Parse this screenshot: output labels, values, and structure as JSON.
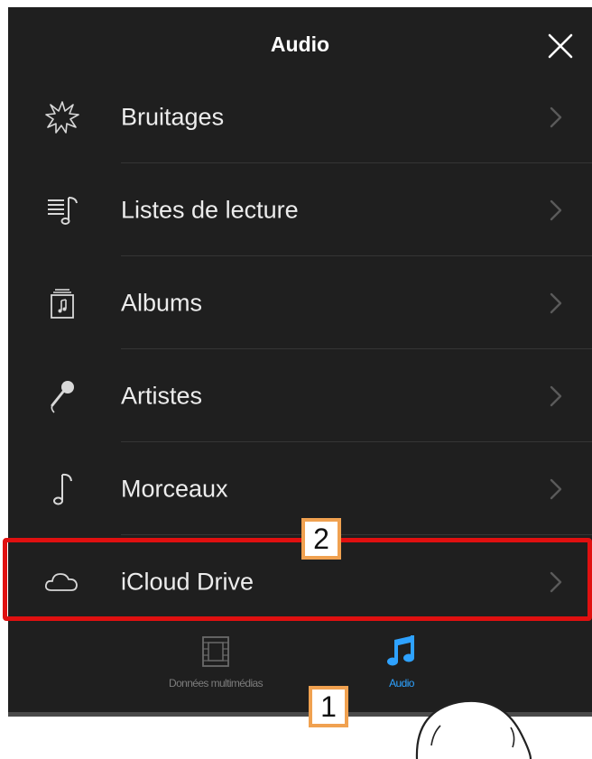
{
  "header": {
    "title": "Audio"
  },
  "list": {
    "items": [
      {
        "label": "Bruitages",
        "icon": "sound-effects-icon"
      },
      {
        "label": "Listes de lecture",
        "icon": "playlist-icon"
      },
      {
        "label": "Albums",
        "icon": "album-icon"
      },
      {
        "label": "Artistes",
        "icon": "microphone-icon"
      },
      {
        "label": "Morceaux",
        "icon": "music-note-icon"
      },
      {
        "label": "iCloud Drive",
        "icon": "cloud-icon"
      }
    ]
  },
  "tabbar": {
    "tabs": [
      {
        "label": "Données multimédias",
        "icon": "film-strip-icon",
        "selected": false
      },
      {
        "label": "Audio",
        "icon": "music-notes-icon",
        "selected": true
      }
    ]
  },
  "annotations": {
    "step1": "1",
    "step2": "2"
  },
  "colors": {
    "background": "#1f1f1f",
    "accent": "#2ea2ff",
    "highlight": "#e01010",
    "badge_border": "#f0a150"
  }
}
